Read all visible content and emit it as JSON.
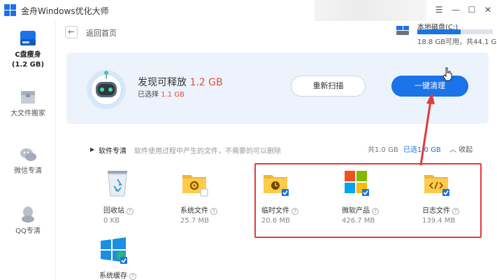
{
  "app": {
    "title": "金舟Windows优化大师"
  },
  "window_controls": {
    "menu": "☰",
    "minimize": "—",
    "maximize": "☐",
    "close": "✕"
  },
  "sidebar": {
    "items": [
      {
        "label": "C盘瘦身",
        "sub": "(1.2 GB)",
        "icon": "drive-icon",
        "active": true
      },
      {
        "label": "大文件搬家",
        "icon": "box-icon"
      },
      {
        "label": "微信专清",
        "icon": "wechat-icon"
      },
      {
        "label": "QQ专清",
        "icon": "qq-icon"
      }
    ]
  },
  "topbar": {
    "back_icon": "←",
    "back_label": "返回首页"
  },
  "disk": {
    "name": "本地磁盘(C:)",
    "info": "18.8 GB可用，共44.1 GB",
    "used_fraction": 0.574
  },
  "scan": {
    "found_prefix": "发现可释放 ",
    "found_value": "1.2 GB",
    "selected_prefix": "已选择 ",
    "selected_value": "1.1 GB",
    "rescan_label": "重新扫描",
    "clean_label": "一键清理"
  },
  "section": {
    "marker": "▶",
    "title": "软件专清",
    "desc": "软件使用过程中产生的文件，不需要的可以删除",
    "total": "共1.0 GB",
    "selected": "已选1.0 GB",
    "collapse_label": "收起",
    "collapse_icon": "︿"
  },
  "items": [
    {
      "name": "回收站",
      "size": "0 KB",
      "icon": "recycle-bin-icon",
      "checked": false
    },
    {
      "name": "系统文件",
      "size": "25.7 MB",
      "icon": "gear-folder-icon",
      "checked": false
    },
    {
      "name": "临时文件",
      "size": "20.6 MB",
      "icon": "clock-folder-icon",
      "checked": true
    },
    {
      "name": "微软产品",
      "size": "426.7 MB",
      "icon": "microsoft-logo-icon",
      "checked": true
    },
    {
      "name": "日志文件",
      "size": "139.4 MB",
      "icon": "code-folder-icon",
      "checked": true
    },
    {
      "name": "系统缓存",
      "size": "",
      "icon": "windows-logo-icon",
      "checked": true
    }
  ],
  "help_glyph": "?",
  "colors": {
    "accent": "#1a73e8",
    "highlight": "#e64c3c",
    "annotation": "#e03b3b",
    "banner_bg": "#ecf3fc"
  }
}
